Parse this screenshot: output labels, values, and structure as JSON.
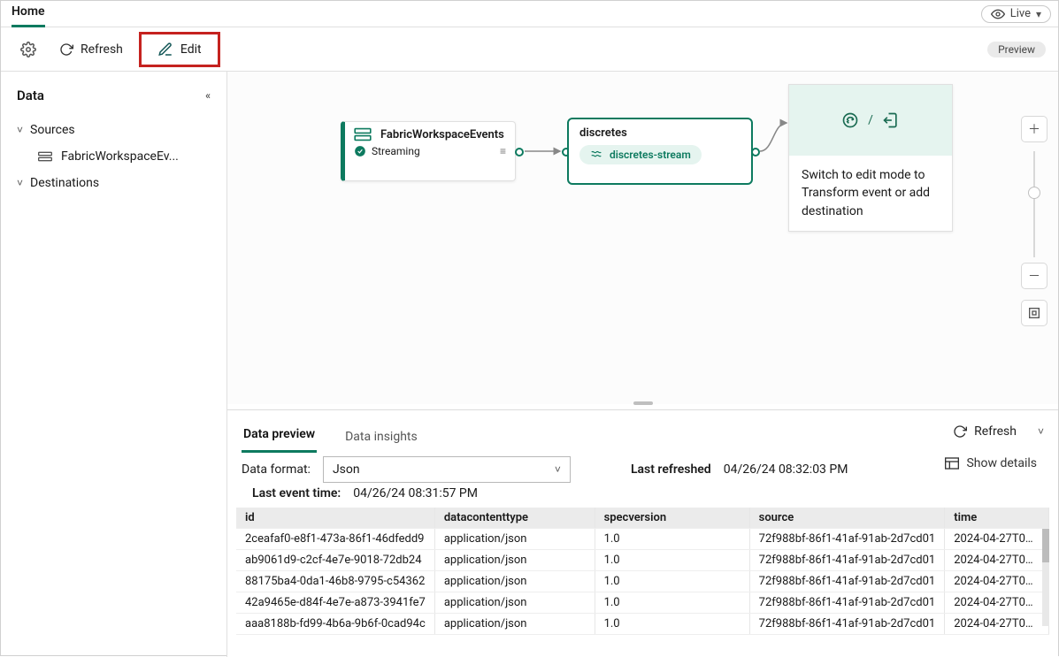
{
  "titlebar": {
    "title": "Home",
    "live_label": "Live"
  },
  "toolbar": {
    "refresh_label": "Refresh",
    "edit_label": "Edit",
    "preview_label": "Preview"
  },
  "sidebar": {
    "header": "Data",
    "sections": {
      "sources": {
        "label": "Sources",
        "items": [
          "FabricWorkspaceEv..."
        ]
      },
      "destinations": {
        "label": "Destinations"
      }
    }
  },
  "canvas": {
    "source_node": {
      "title": "FabricWorkspaceEvents",
      "status": "Streaming"
    },
    "stream_node": {
      "title": "discretes",
      "chip": "discretes-stream"
    },
    "dest_node": {
      "separator": "/",
      "message": "Switch to edit mode to Transform event or add destination"
    }
  },
  "preview": {
    "tabs": {
      "data_preview": "Data preview",
      "data_insights": "Data insights"
    },
    "refresh_label": "Refresh",
    "data_format_label": "Data format:",
    "data_format_value": "Json",
    "last_refreshed_label": "Last refreshed",
    "last_refreshed_value": "04/26/24 08:32:03 PM",
    "last_event_label": "Last event time:",
    "last_event_value": "04/26/24 08:31:57 PM",
    "show_details_label": "Show details",
    "columns": [
      "id",
      "datacontenttype",
      "specversion",
      "source",
      "time"
    ],
    "rows": [
      {
        "id": "2ceafaf0-e8f1-473a-86f1-46dfedd9",
        "datacontenttype": "application/json",
        "specversion": "1.0",
        "source": "72f988bf-86f1-41af-91ab-2d7cd01",
        "time": "2024-04-27T0…"
      },
      {
        "id": "ab9061d9-c2cf-4e7e-9018-72db24",
        "datacontenttype": "application/json",
        "specversion": "1.0",
        "source": "72f988bf-86f1-41af-91ab-2d7cd01",
        "time": "2024-04-27T0…"
      },
      {
        "id": "88175ba4-0da1-46b8-9795-c54362",
        "datacontenttype": "application/json",
        "specversion": "1.0",
        "source": "72f988bf-86f1-41af-91ab-2d7cd01",
        "time": "2024-04-27T0…"
      },
      {
        "id": "42a9465e-d84f-4e7e-a873-3941fe7",
        "datacontenttype": "application/json",
        "specversion": "1.0",
        "source": "72f988bf-86f1-41af-91ab-2d7cd01",
        "time": "2024-04-27T0…"
      },
      {
        "id": "aaa8188b-fd99-4b6a-9b6f-0cad94c",
        "datacontenttype": "application/json",
        "specversion": "1.0",
        "source": "72f988bf-86f1-41af-91ab-2d7cd01",
        "time": "2024-04-27T0…"
      }
    ]
  }
}
